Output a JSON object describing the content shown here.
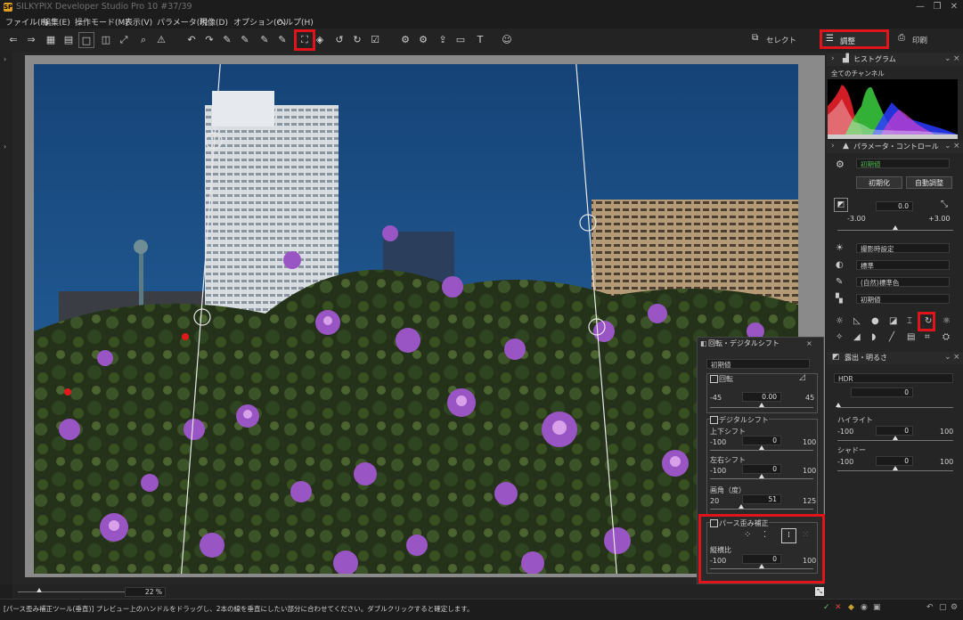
{
  "window": {
    "title": "SILKYPIX Developer Studio Pro 10   #37/39",
    "logo_text": "SP"
  },
  "window_controls": [
    "—",
    "❐",
    "✕"
  ],
  "menu": [
    "ファイル(F)",
    "編集(E)",
    "操作モード(M)",
    "表示(V)",
    "パラメータ(P)",
    "現像(D)",
    "オプション(O)",
    "ヘルプ(H)"
  ],
  "toolbar": {
    "icons": [
      "arrow-left-icon",
      "arrow-right-icon",
      "grid-icon",
      "list-icon",
      "single-view-icon",
      "compare-icon",
      "fullscreen-icon",
      "zoom-icon",
      "warning-icon",
      "undo-icon",
      "redo-icon",
      "eyedropper-icon",
      "eyedropper-plus-icon",
      "eyedropper-gray-icon",
      "eyedropper-skin-icon",
      "perspective-vertical-icon",
      "layers-icon",
      "rotate-left-icon",
      "rotate-right-icon",
      "checkbox-icon",
      "develop-icon",
      "batch-develop-icon",
      "export-icon",
      "display-icon",
      "text-icon",
      "user-search-icon"
    ],
    "glyphs": [
      "⇐",
      "⇒",
      "▦",
      "▤",
      "□",
      "◫",
      "⤢",
      "⌕",
      "⚠",
      "↶",
      "↷",
      "✎",
      "✎",
      "✎",
      "✎",
      "⛶",
      "◈",
      "↺",
      "↻",
      "☑",
      "⚙",
      "⚙",
      "⇪",
      "▭",
      "T",
      "☺"
    ]
  },
  "modes": {
    "select": "セレクト",
    "adjust": "調整",
    "print": "印刷"
  },
  "accent": "#e0141b",
  "histogram": {
    "title": "ヒストグラム",
    "channel": "全てのチャンネル",
    "colors": {
      "red": "#e8202a",
      "green": "#3cd040",
      "blue": "#2a3cff",
      "magenta": "#d040d0",
      "white": "#ffffff"
    }
  },
  "param_control": {
    "title": "パラメータ・コントロール",
    "preset": "初期値",
    "init_button": "初期化",
    "auto_button": "自動調整",
    "exposure_value": "0.0",
    "exposure_min": "-3.00",
    "exposure_max": "+3.00",
    "exposure_position": 0.5,
    "white_balance": "撮影時設定",
    "tone": "標準",
    "color": "(自然)標準色",
    "sharpness": "初期値"
  },
  "exposure_panel": {
    "title": "露出・明るさ",
    "mode": "HDR",
    "hdr_value": "0",
    "highlight_label": "ハイライト",
    "highlight_min": "-100",
    "highlight_max": "100",
    "highlight_value": "0",
    "shadow_label": "シャドー",
    "shadow_min": "-100",
    "shadow_max": "100",
    "shadow_value": "0"
  },
  "rotate_panel": {
    "title": "回転・デジタルシフト",
    "preset": "初期値",
    "rotate_label": "回転",
    "rotate_min": "-45",
    "rotate_max": "45",
    "rotate_value": "0.00",
    "shift_group": "デジタルシフト",
    "vshift_label": "上下シフト",
    "vshift_min": "-100",
    "vshift_max": "100",
    "vshift_value": "0",
    "hshift_label": "左右シフト",
    "hshift_min": "-100",
    "hshift_max": "100",
    "hshift_value": "0",
    "fov_label": "画角（度）",
    "fov_min": "20",
    "fov_max": "125",
    "fov_value": "51",
    "perspective_group": "パース歪み補正",
    "aspect_label": "縦横比",
    "aspect_min": "-100",
    "aspect_max": "100",
    "aspect_value": "0"
  },
  "zoom": {
    "value": "22",
    "unit": "%"
  },
  "status": "[パース歪み補正ツール(垂直)] プレビュー上のハンドルをドラッグし、2本の線を垂直にしたい部分に合わせてください。ダブルクリックすると確定します。",
  "photo_colors": {
    "sky": "#1b4f86",
    "foliage": "#2c3a1e",
    "flower": "#9a4fc0"
  }
}
